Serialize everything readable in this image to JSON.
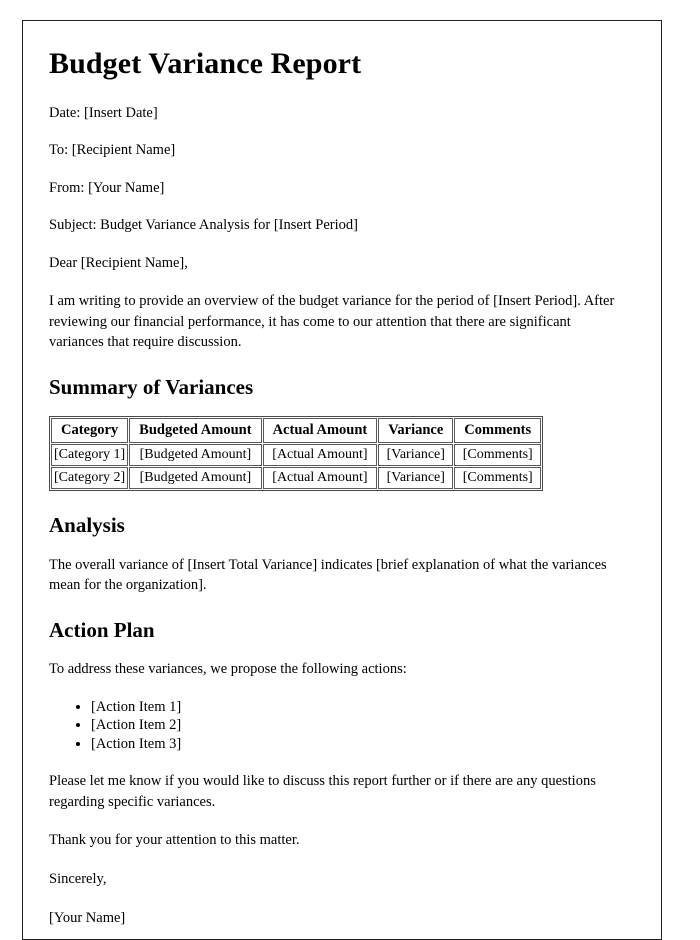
{
  "document": {
    "title": "Budget Variance Report",
    "meta": [
      "Date: [Insert Date]",
      "To: [Recipient Name]",
      "From: [Your Name]",
      "Subject: Budget Variance Analysis for [Insert Period]"
    ],
    "salutation": "Dear [Recipient Name],",
    "intro_paragraph": "I am writing to provide an overview of the budget variance for the period of [Insert Period]. After reviewing our financial performance, it has come to our attention that there are significant variances that require discussion.",
    "sections": {
      "summary": {
        "heading": "Summary of Variances",
        "table": {
          "columns": [
            "Category",
            "Budgeted Amount",
            "Actual Amount",
            "Variance",
            "Comments"
          ],
          "rows": [
            [
              "[Category 1]",
              "[Budgeted Amount]",
              "[Actual Amount]",
              "[Variance]",
              "[Comments]"
            ],
            [
              "[Category 2]",
              "[Budgeted Amount]",
              "[Actual Amount]",
              "[Variance]",
              "[Comments]"
            ]
          ]
        }
      },
      "analysis": {
        "heading": "Analysis",
        "paragraph": "The overall variance of [Insert Total Variance] indicates [brief explanation of what the variances mean for the organization]."
      },
      "action_plan": {
        "heading": "Action Plan",
        "intro": "To address these variances, we propose the following actions:",
        "items": [
          "[Action Item 1]",
          "[Action Item 2]",
          "[Action Item 3]"
        ]
      }
    },
    "closing": {
      "request": "Please let me know if you would like to discuss this report further or if there are any questions regarding specific variances.",
      "thanks": "Thank you for your attention to this matter.",
      "signoff": "Sincerely,",
      "signature": "[Your Name]"
    }
  }
}
